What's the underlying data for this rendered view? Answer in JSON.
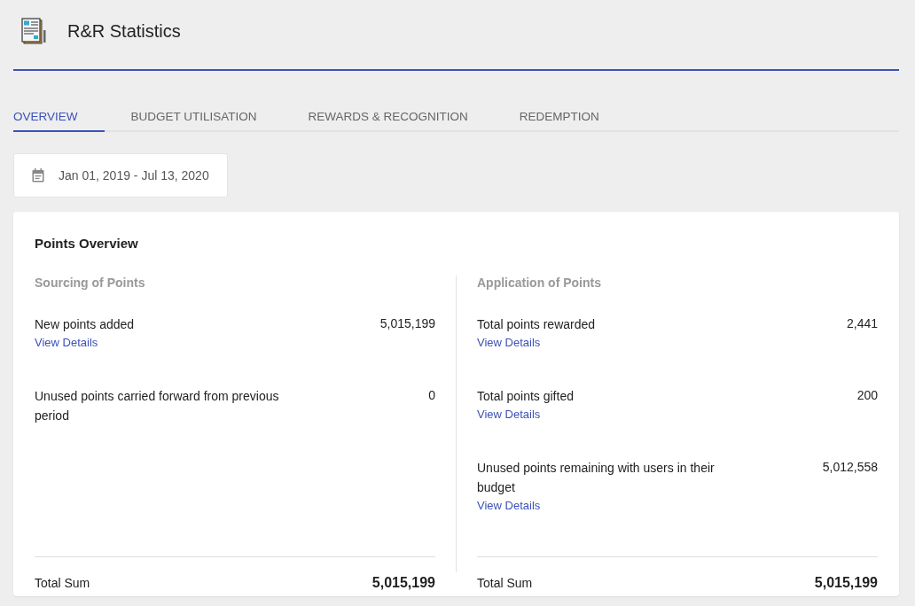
{
  "header": {
    "title": "R&R Statistics"
  },
  "tabs": [
    {
      "label": "OVERVIEW",
      "selected": true
    },
    {
      "label": "BUDGET UTILISATION",
      "selected": false
    },
    {
      "label": "REWARDS & RECOGNITION",
      "selected": false
    },
    {
      "label": "REDEMPTION",
      "selected": false
    }
  ],
  "date_range": "Jan 01, 2019 - Jul 13, 2020",
  "card": {
    "title": "Points Overview",
    "sections": [
      {
        "heading": "Sourcing of Points",
        "items": [
          {
            "label": "New points added",
            "value": "5,015,199",
            "link": "View Details"
          },
          {
            "label": "Unused points carried forward from previous period",
            "value": "0"
          }
        ],
        "total_label": "Total Sum",
        "total_value": "5,015,199"
      },
      {
        "heading": "Application of Points",
        "items": [
          {
            "label": "Total points rewarded",
            "value": "2,441",
            "link": "View Details"
          },
          {
            "label": "Total points gifted",
            "value": "200",
            "link": "View Details"
          },
          {
            "label": "Unused points remaining with users in their budget",
            "value": "5,012,558",
            "link": "View Details"
          }
        ],
        "total_label": "Total Sum",
        "total_value": "5,015,199"
      }
    ]
  }
}
